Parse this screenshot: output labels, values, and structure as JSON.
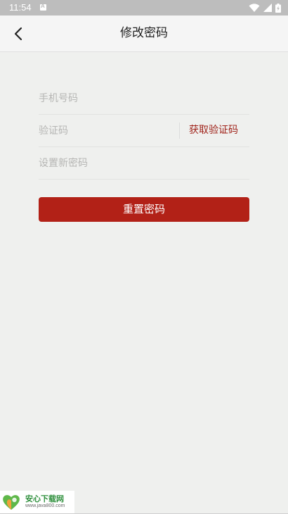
{
  "status_bar": {
    "time": "11:54",
    "icons": [
      "notification-a-icon",
      "wifi-icon",
      "signal-icon",
      "battery-icon"
    ]
  },
  "header": {
    "back_icon": "chevron-left-icon",
    "title": "修改密码"
  },
  "form": {
    "phone_placeholder": "手机号码",
    "phone_value": "",
    "code_placeholder": "验证码",
    "code_value": "",
    "get_code_label": "获取验证码",
    "new_password_placeholder": "设置新密码",
    "new_password_value": ""
  },
  "actions": {
    "reset_label": "重置密码"
  },
  "watermark": {
    "title": "安心下载网",
    "url": "www.java800.com"
  },
  "colors": {
    "accent": "#b22117",
    "link": "#a0241b",
    "background": "#eff0ee",
    "header_bg": "#f5f5f5",
    "status_bar_bg": "#bdbdbd"
  }
}
